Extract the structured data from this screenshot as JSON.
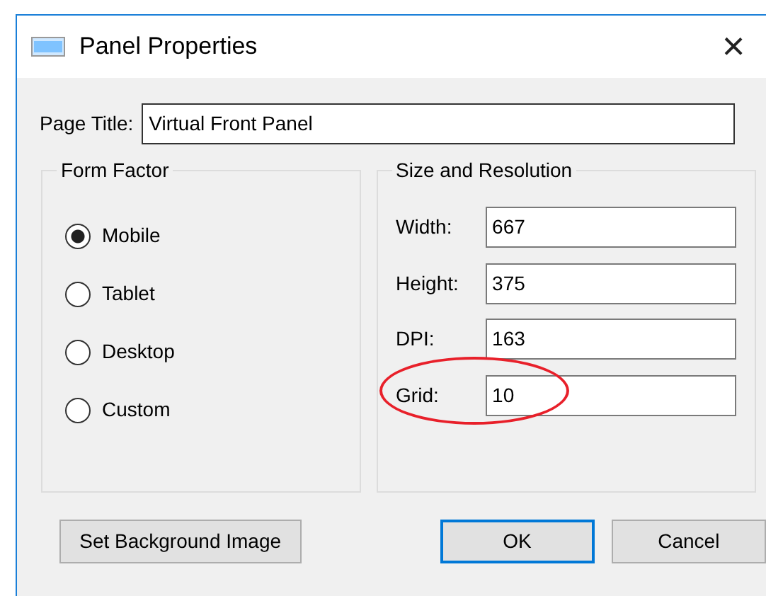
{
  "window": {
    "title": "Panel Properties",
    "close": "×"
  },
  "page_title": {
    "label": "Page Title:",
    "value": "Virtual Front Panel"
  },
  "form_factor": {
    "legend": "Form Factor",
    "options": [
      {
        "label": "Mobile",
        "selected": true
      },
      {
        "label": "Tablet",
        "selected": false
      },
      {
        "label": "Desktop",
        "selected": false
      },
      {
        "label": "Custom",
        "selected": false
      }
    ]
  },
  "size": {
    "legend": "Size and Resolution",
    "fields": [
      {
        "label": "Width:",
        "value": "667",
        "highlighted": false
      },
      {
        "label": "Height:",
        "value": "375",
        "highlighted": false
      },
      {
        "label": "DPI:",
        "value": "163",
        "highlighted": false
      },
      {
        "label": "Grid:",
        "value": "10",
        "highlighted": true
      }
    ]
  },
  "buttons": [
    {
      "label": "Set Background Image",
      "default": false
    },
    {
      "label": "OK",
      "default": true
    },
    {
      "label": "Cancel",
      "default": false
    }
  ]
}
